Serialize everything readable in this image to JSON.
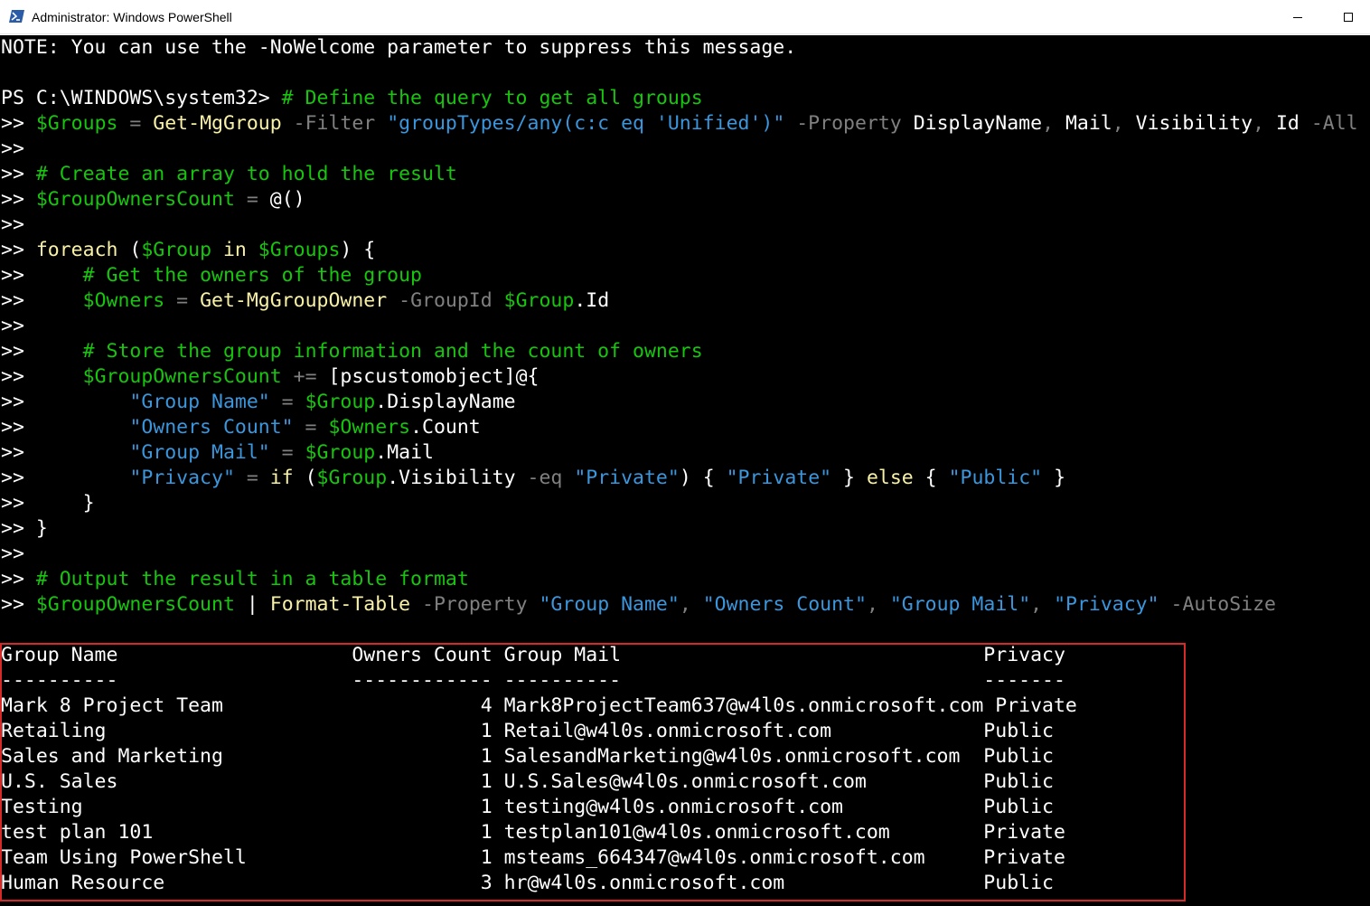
{
  "window": {
    "title": "Administrator: Windows PowerShell"
  },
  "colors": {
    "comment": "#16c60c",
    "variable": "#16c60c",
    "command": "#f9f1a5",
    "string": "#3a96dd",
    "parameter": "#808080",
    "text": "#ffffff",
    "highlight_box": "#d52a2a"
  },
  "console": {
    "note": "NOTE: You can use the -NoWelcome parameter to suppress this message.",
    "prompt": "PS C:\\WINDOWS\\system32>",
    "cont": ">>",
    "code": {
      "l1_comment": "# Define the query to get all groups",
      "l2_var": "$Groups",
      "l2_eq": " = ",
      "l2_cmd": "Get-MgGroup",
      "l2_p1": " -Filter ",
      "l2_s1": "\"groupTypes/any(c:c eq 'Unified')\"",
      "l2_p2": " -Property ",
      "l2_props1": "DisplayName",
      "l2_comma1": ", ",
      "l2_props2": "Mail",
      "l2_comma2": ", ",
      "l2_props3": "Visibility",
      "l2_comma3": ", ",
      "l2_props4": "Id",
      "l2_p3": " -All",
      "l4_comment": "# Create an array to hold the result",
      "l5_var": "$GroupOwnersCount",
      "l5_eq": " = ",
      "l5_val": "@()",
      "l7_kw": "foreach",
      "l7_open": " (",
      "l7_var1": "$Group",
      "l7_in": " in ",
      "l7_var2": "$Groups",
      "l7_close": ") {",
      "l8_comment": "# Get the owners of the group",
      "l9_var": "$Owners",
      "l9_eq": " = ",
      "l9_cmd": "Get-MgGroupOwner",
      "l9_p": " -GroupId ",
      "l9_var2": "$Group",
      "l9_prop": ".Id",
      "l11_comment": "# Store the group information and the count of owners",
      "l12_var": "$GroupOwnersCount",
      "l12_op": " += ",
      "l12_rest": "[pscustomobject]@{",
      "l13_s": "\"Group Name\"",
      "l13_eq": " = ",
      "l13_var": "$Group",
      "l13_prop": ".DisplayName",
      "l14_s": "\"Owners Count\"",
      "l14_eq": " = ",
      "l14_var": "$Owners",
      "l14_prop": ".Count",
      "l15_s": "\"Group Mail\"",
      "l15_eq": " = ",
      "l15_var": "$Group",
      "l15_prop": ".Mail",
      "l16_s": "\"Privacy\"",
      "l16_eq": " = ",
      "l16_kw": "if",
      "l16_open": " (",
      "l16_var": "$Group",
      "l16_prop": ".Visibility",
      "l16_op": " -eq ",
      "l16_s2": "\"Private\"",
      "l16_b1": ") { ",
      "l16_s3": "\"Private\"",
      "l16_b2": " } ",
      "l16_kw2": "else",
      "l16_b3": " { ",
      "l16_s4": "\"Public\"",
      "l16_b4": " }",
      "l17": "}",
      "l18": "}",
      "l20_comment": "# Output the result in a table format",
      "l21_var": "$GroupOwnersCount",
      "l21_pipe": " | ",
      "l21_cmd": "Format-Table",
      "l21_p": " -Property ",
      "l21_s1": "\"Group Name\"",
      "l21_c1": ", ",
      "l21_s2": "\"Owners Count\"",
      "l21_c2": ", ",
      "l21_s3": "\"Group Mail\"",
      "l21_c3": ", ",
      "l21_s4": "\"Privacy\"",
      "l21_p2": " -AutoSize"
    },
    "table": {
      "header_line": "Group Name                    Owners Count Group Mail                               Privacy",
      "separator_line": "----------                    ------------ ----------                               -------",
      "rows": [
        "Mark 8 Project Team                      4 Mark8ProjectTeam637@w4l0s.onmicrosoft.com Private",
        "Retailing                                1 Retail@w4l0s.onmicrosoft.com             Public",
        "Sales and Marketing                      1 SalesandMarketing@w4l0s.onmicrosoft.com  Public",
        "U.S. Sales                               1 U.S.Sales@w4l0s.onmicrosoft.com          Public",
        "Testing                                  1 testing@w4l0s.onmicrosoft.com            Public",
        "test plan 101                            1 testplan101@w4l0s.onmicrosoft.com        Private",
        "Team Using PowerShell                    1 msteams_664347@w4l0s.onmicrosoft.com     Private",
        "Human Resource                           3 hr@w4l0s.onmicrosoft.com                 Public"
      ]
    }
  }
}
